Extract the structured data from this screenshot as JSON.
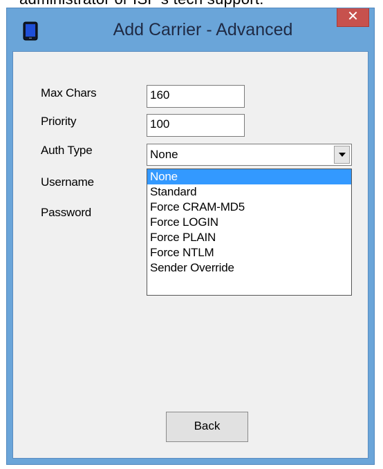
{
  "background_text": "administrator or ISP's tech support.",
  "window": {
    "title": "Add Carrier - Advanced",
    "close_label": "✕"
  },
  "form": {
    "max_chars": {
      "label": "Max Chars",
      "value": "160"
    },
    "priority": {
      "label": "Priority",
      "value": "100"
    },
    "auth_type": {
      "label": "Auth Type",
      "value": "None"
    },
    "username": {
      "label": "Username"
    },
    "password": {
      "label": "Password"
    }
  },
  "dropdown": {
    "options": [
      "None",
      "Standard",
      "Force CRAM-MD5",
      "Force LOGIN",
      "Force PLAIN",
      "Force NTLM",
      "Sender Override"
    ],
    "selected": "None"
  },
  "buttons": {
    "back_label": "Back"
  },
  "colors": {
    "title_bar": "#6aa5d9",
    "close_button": "#c7514d",
    "selection": "#3399ff"
  }
}
